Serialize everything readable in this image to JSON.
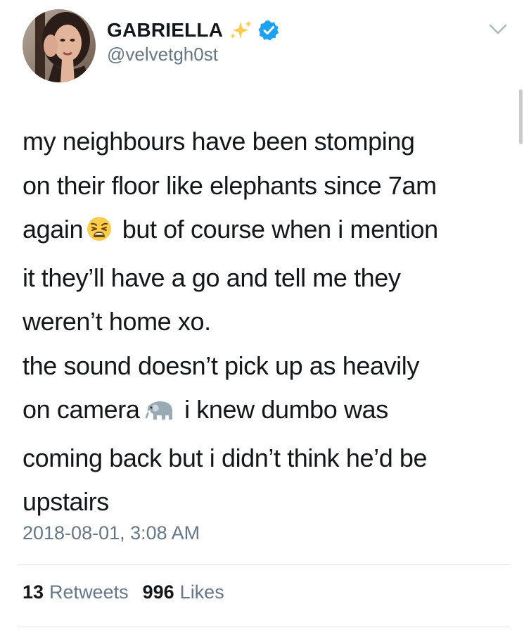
{
  "user": {
    "display_name": "GABRIELLA",
    "handle": "@velvetgh0st",
    "verified": true
  },
  "icons": {
    "avatar": "profile-photo",
    "sparkles": "sparkles-emoji-icon",
    "verified": "verified-badge-icon",
    "caret": "chevron-down-icon",
    "weary_emoji": "weary-face-emoji-icon",
    "elephant_emoji": "elephant-emoji-icon"
  },
  "tweet": {
    "lines": [
      "my neighbours have been stomping",
      "on their floor like elephants since 7am",
      "again",
      "but of course when i mention",
      "it they’ll have a go and tell me they",
      "weren’t home xo.",
      "the sound doesn’t pick up as heavily",
      "on camera",
      "i knew dumbo was",
      "coming back but i didn’t think he’d be",
      "upstairs"
    ],
    "timestamp": "2018-08-01, 3:08 AM"
  },
  "stats": {
    "retweets_count": "13",
    "retweets_label": "Retweets",
    "likes_count": "996",
    "likes_label": "Likes"
  },
  "colors": {
    "text": "#14171a",
    "secondary": "#657786",
    "verified_blue": "#1da1f2",
    "divider": "#e1e8ed"
  }
}
